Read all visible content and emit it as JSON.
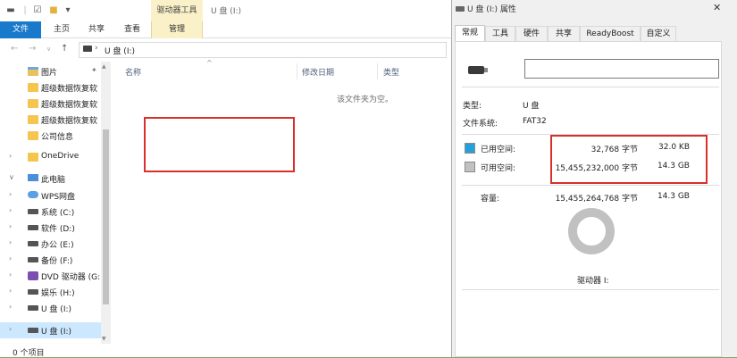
{
  "explorer": {
    "context_tab_header": "驱动器工具",
    "window_title": "U 盘 (I:)",
    "ribbon_tabs": {
      "file": "文件",
      "home": "主页",
      "share": "共享",
      "view": "查看",
      "manage": "管理"
    },
    "address": {
      "separator": "›",
      "path": "U 盘 (I:)"
    },
    "nav_items": [
      {
        "label": "图片",
        "icon": "pictures-icon",
        "pinned": true
      },
      {
        "label": "超级数据恢复软",
        "icon": "folder-icon"
      },
      {
        "label": "超级数据恢复软",
        "icon": "folder-icon"
      },
      {
        "label": "超级数据恢复软",
        "icon": "folder-icon"
      },
      {
        "label": "公司信息",
        "icon": "folder-icon"
      },
      {
        "label": "OneDrive",
        "icon": "folder-icon"
      },
      {
        "label": "此电脑",
        "icon": "computer-icon"
      },
      {
        "label": "WPS网盘",
        "icon": "cloud-icon"
      },
      {
        "label": "系统 (C:)",
        "icon": "drive-icon"
      },
      {
        "label": "软件 (D:)",
        "icon": "drive-icon"
      },
      {
        "label": "办公 (E:)",
        "icon": "drive-icon"
      },
      {
        "label": "备份 (F:)",
        "icon": "drive-icon"
      },
      {
        "label": "DVD 驱动器 (G:",
        "icon": "dvd-icon"
      },
      {
        "label": "娱乐 (H:)",
        "icon": "drive-icon"
      },
      {
        "label": "U 盘 (I:)",
        "icon": "drive-icon"
      },
      {
        "label": "U 盘 (I:)",
        "icon": "drive-icon",
        "selected": true
      }
    ],
    "columns": {
      "name": "名称",
      "date": "修改日期",
      "type": "类型"
    },
    "empty_message": "该文件夹为空。",
    "status": "0 个项目"
  },
  "properties": {
    "title": "U 盘 (I:) 属性",
    "tabs": [
      "常规",
      "工具",
      "硬件",
      "共享",
      "ReadyBoost",
      "自定义"
    ],
    "name_value": "",
    "type_label": "类型:",
    "type_value": "U 盘",
    "fs_label": "文件系统:",
    "fs_value": "FAT32",
    "used_label": "已用空间:",
    "used_bytes": "32,768 字节",
    "used_human": "32.0 KB",
    "free_label": "可用空间:",
    "free_bytes": "15,455,232,000 字节",
    "free_human": "14.3 GB",
    "capacity_label": "容量:",
    "capacity_bytes": "15,455,264,768 字节",
    "capacity_human": "14.3 GB",
    "drive_label": "驱动器 I:",
    "used_fraction": 2.1e-06,
    "colors": {
      "used": "#26a0da",
      "free": "#c1c1c1",
      "highlight": "#d9302c"
    }
  }
}
